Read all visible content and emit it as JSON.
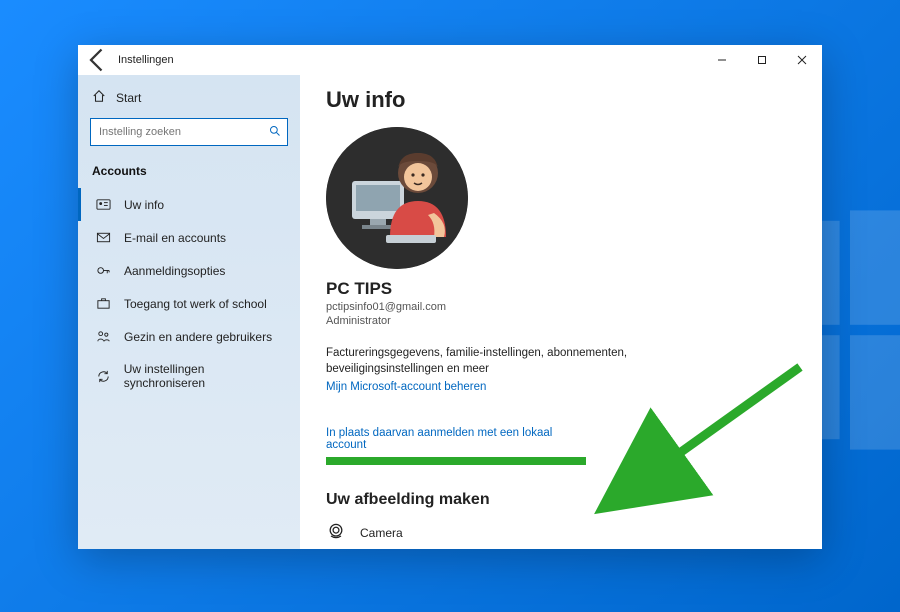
{
  "titlebar": {
    "title": "Instellingen"
  },
  "sidebar": {
    "home": "Start",
    "search_placeholder": "Instelling zoeken",
    "section": "Accounts",
    "items": [
      {
        "label": "Uw info"
      },
      {
        "label": "E-mail en accounts"
      },
      {
        "label": "Aanmeldingsopties"
      },
      {
        "label": "Toegang tot werk of school"
      },
      {
        "label": "Gezin en andere gebruikers"
      },
      {
        "label": "Uw instellingen synchroniseren"
      }
    ]
  },
  "main": {
    "heading": "Uw info",
    "username": "PC TIPS",
    "email": "pctipsinfo01@gmail.com",
    "role": "Administrator",
    "billing_text": "Factureringsgegevens, familie-instellingen, abonnementen, beveiligingsinstellingen en meer",
    "manage_link": "Mijn Microsoft-account beheren",
    "local_account_link": "In plaats daarvan aanmelden met een lokaal account",
    "sub_heading": "Uw afbeelding maken",
    "camera": "Camera"
  }
}
